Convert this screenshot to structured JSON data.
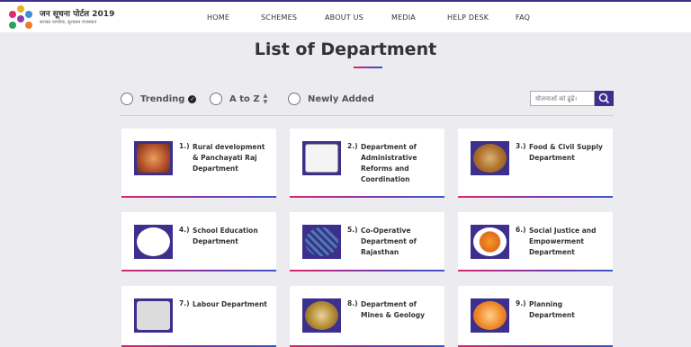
{
  "header": {
    "brand_title": "जन सूचना पोर्टल 2019",
    "brand_subtitle": "सशक्त नागरिक, सुशासन राजस्थान",
    "nav": [
      "HOME",
      "SCHEMES",
      "ABOUT US",
      "MEDIA",
      "HELP DESK",
      "FAQ"
    ]
  },
  "page": {
    "title": "List of Department"
  },
  "filters": [
    {
      "label": "Trending"
    },
    {
      "label": "A to Z"
    },
    {
      "label": "Newly Added"
    }
  ],
  "search": {
    "placeholder": "योजनाओं को ढूंढें।"
  },
  "departments": [
    {
      "num": "1.)",
      "name": "Rural development & Panchayati Raj Department"
    },
    {
      "num": "2.)",
      "name": "Department of Administrative Reforms and Coordination"
    },
    {
      "num": "3.)",
      "name": "Food & Civil Supply Department"
    },
    {
      "num": "4.)",
      "name": "School Education Department"
    },
    {
      "num": "5.)",
      "name": "Co-Operative Department of Rajasthan"
    },
    {
      "num": "6.)",
      "name": "Social Justice and Empowerment Department"
    },
    {
      "num": "7.)",
      "name": "Labour Department"
    },
    {
      "num": "8.)",
      "name": "Department of Mines & Geology"
    },
    {
      "num": "9.)",
      "name": "Planning Department"
    }
  ],
  "colors": {
    "primary": "#3c2f8e",
    "accent_pink": "#d8286f",
    "accent_blue": "#3c57c8",
    "background": "#ebebf0"
  }
}
